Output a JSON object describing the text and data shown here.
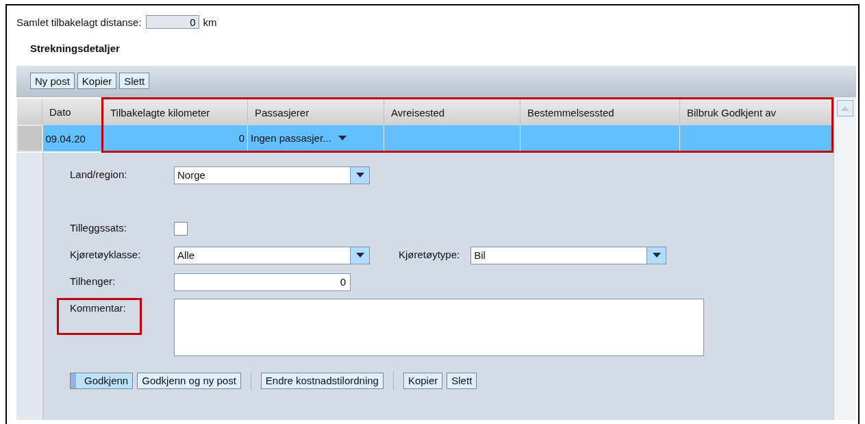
{
  "total_distance": {
    "label": "Samlet tilbakelagt distanse:",
    "value": "0",
    "unit": "km"
  },
  "section_title": "Strekningsdetaljer",
  "toolbar": [
    "Ny post",
    "Kopier",
    "Slett"
  ],
  "table": {
    "columns": [
      "Dato",
      "Tilbakelagte kilometer",
      "Passasjerer",
      "Avreisested",
      "Bestemmelsessted",
      "Bilbruk Godkjent av"
    ],
    "rows": [
      {
        "selected": true,
        "dato": "09.04.20",
        "km": "0",
        "passengers": "Ingen passasjer..."
      }
    ]
  },
  "form_rows": [
    {
      "fields": [
        {
          "kind": "select",
          "label": "Land/region:",
          "value": "Norge"
        }
      ]
    },
    {
      "fields": [
        {
          "kind": "checkbox",
          "label": "Tilleggssats:",
          "checked": false
        }
      ]
    },
    {
      "fields": [
        {
          "kind": "select",
          "label": "Kjøretøyklasse:",
          "value": "Alle"
        },
        {
          "kind": "select",
          "label": "Kjøretøytype:",
          "value": "Bil"
        }
      ]
    },
    {
      "fields": [
        {
          "kind": "number",
          "label": "Tilhenger:",
          "value": "0"
        }
      ]
    },
    {
      "fields": [
        {
          "kind": "textarea",
          "label": "Kommentar:"
        }
      ]
    }
  ],
  "actions": [
    [
      {
        "label": "Godkjenn",
        "default": true
      },
      {
        "label": "Godkjenn og ny post",
        "default": false
      }
    ],
    [
      {
        "label": "Endre kostnadstilordning",
        "default": false
      }
    ],
    [
      {
        "label": "Kopier",
        "default": false
      },
      {
        "label": "Slett",
        "default": false
      }
    ]
  ]
}
